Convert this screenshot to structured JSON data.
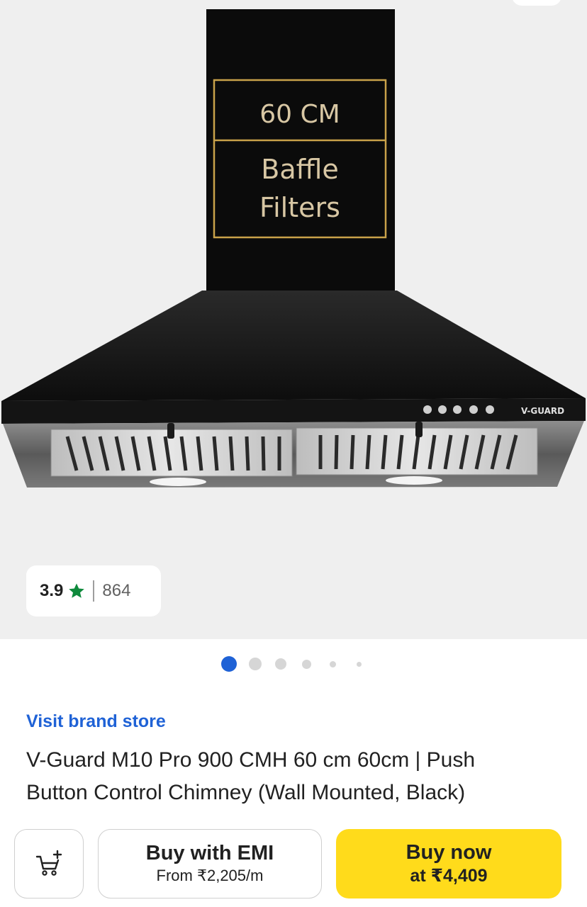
{
  "gallery": {
    "image_text": {
      "size": "60 CM",
      "filter_line1": "Baffle",
      "filter_line2": "Filters",
      "brand_logo": "V-GUARD"
    },
    "rating": {
      "value": "3.9",
      "count": "864",
      "star_icon": "star-icon",
      "star_color": "#0f8a3c"
    },
    "dots": {
      "count": 6,
      "active_index": 0,
      "active_color": "#1f62d6"
    }
  },
  "product": {
    "brand_link": "Visit brand store",
    "title_line1": "V-Guard M10 Pro 900 CMH 60 cm 60cm | Push",
    "title_line2": "Button Control Chimney (Wall Mounted, Black)"
  },
  "actions": {
    "cart_icon": "add-to-cart-icon",
    "emi_label": "Buy with EMI",
    "emi_sub": "From ₹2,205/m",
    "buy_label": "Buy now",
    "buy_sub": "at ₹4,409",
    "buy_color": "#ffdb1b"
  }
}
